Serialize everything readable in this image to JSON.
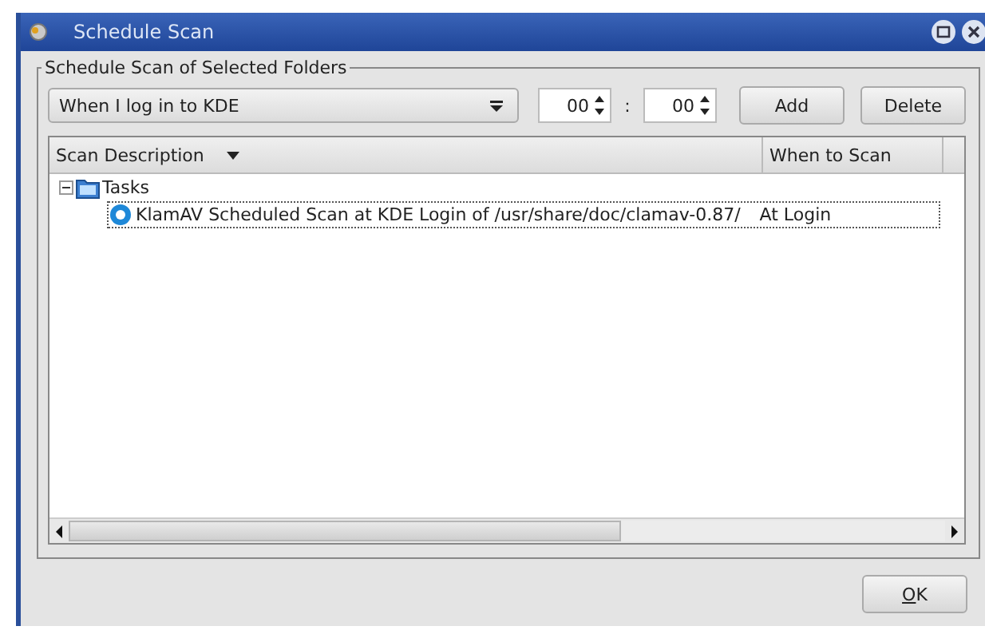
{
  "window": {
    "title": "Schedule Scan"
  },
  "group": {
    "title": "Schedule Scan of Selected Folders"
  },
  "schedule": {
    "value": "When I log in to KDE",
    "hour": "00",
    "separator": ":",
    "minute": "00"
  },
  "buttons": {
    "add": "Add",
    "delete": "Delete",
    "ok": "OK"
  },
  "table": {
    "columns": [
      "Scan Description",
      "When to Scan"
    ],
    "tree": [
      {
        "label": "Tasks",
        "expanded": true,
        "children": [
          {
            "label": "KlamAV Scheduled Scan at KDE Login of /usr/share/doc/clamav-0.87/",
            "when": "At Login",
            "selected": true
          }
        ]
      }
    ]
  }
}
